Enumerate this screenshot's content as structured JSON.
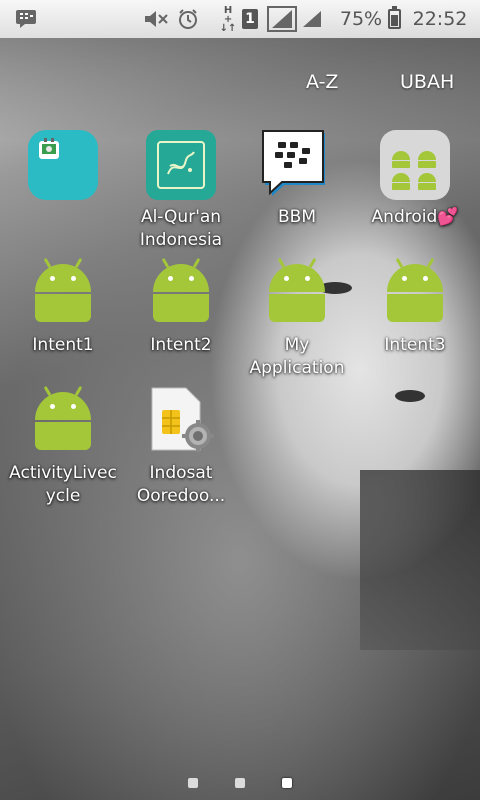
{
  "status_bar": {
    "time": "22:52",
    "battery": "75%",
    "battery_level": 0.75,
    "sim_slot": "1",
    "network_type": "H",
    "icons": [
      "bbm-notification-icon",
      "mute-icon",
      "alarm-icon",
      "network-h-plus-icon",
      "sim-1-icon",
      "signal-icon",
      "signal-icon",
      "battery-icon"
    ]
  },
  "top_actions": {
    "sort": "A-Z",
    "edit": "UBAH"
  },
  "apps": [
    {
      "label": "",
      "icon": "teal-app-icon",
      "color": "#29b9c2"
    },
    {
      "label": "Al-Qur'an\nIndonesia",
      "icon": "quran-icon",
      "color": "#25a797"
    },
    {
      "label": "BBM",
      "icon": "bbm-icon",
      "color": "#2b2b2b"
    },
    {
      "label": "Android💕",
      "icon": "folder-icon",
      "color": "#bfbfbf"
    },
    {
      "label": "Intent1",
      "icon": "android-icon",
      "color": "#a4c639"
    },
    {
      "label": "Intent2",
      "icon": "android-icon",
      "color": "#a4c639"
    },
    {
      "label": "My\nApplication",
      "icon": "android-icon",
      "color": "#a4c639"
    },
    {
      "label": "Intent3",
      "icon": "android-icon",
      "color": "#a4c639"
    },
    {
      "label": "ActivityLivec\nycle",
      "icon": "android-icon",
      "color": "#a4c639"
    },
    {
      "label": "Indosat\nOoredoo...",
      "icon": "sim-toolkit-icon",
      "color": "#f3c31b"
    }
  ],
  "page_indicator": {
    "pages": 3,
    "current": 3
  }
}
